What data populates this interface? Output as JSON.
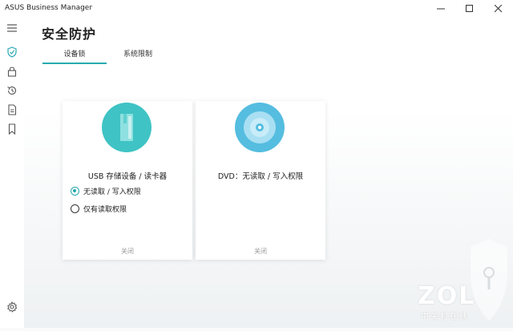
{
  "window": {
    "title": "ASUS Business Manager"
  },
  "page": {
    "title": "安全防护"
  },
  "tabs": [
    {
      "label": "设备锁",
      "active": true
    },
    {
      "label": "系统限制",
      "active": false
    }
  ],
  "sidebar": {
    "icons": [
      "menu-icon",
      "shield-check-icon",
      "lock-icon",
      "history-icon",
      "document-icon",
      "bookmark-icon",
      "gear-icon"
    ],
    "active": "shield-check-icon"
  },
  "cards": [
    {
      "title": "USB 存储设备 / 读卡器",
      "icon": "usb-drive-icon",
      "options": [
        {
          "label": "无读取 / 写入权限",
          "checked": true
        },
        {
          "label": "仅有读取权限",
          "checked": false
        }
      ],
      "status": "关闭"
    },
    {
      "title": "DVD：无读取 / 写入权限",
      "icon": "disc-icon",
      "status": "关闭"
    }
  ],
  "watermark": {
    "text": "ZOL",
    "subtext": "中关村在线"
  },
  "colors": {
    "accent": "#27a9b0",
    "usb_circle": "#3fc3c4",
    "dvd_circle": "#55bde0"
  }
}
